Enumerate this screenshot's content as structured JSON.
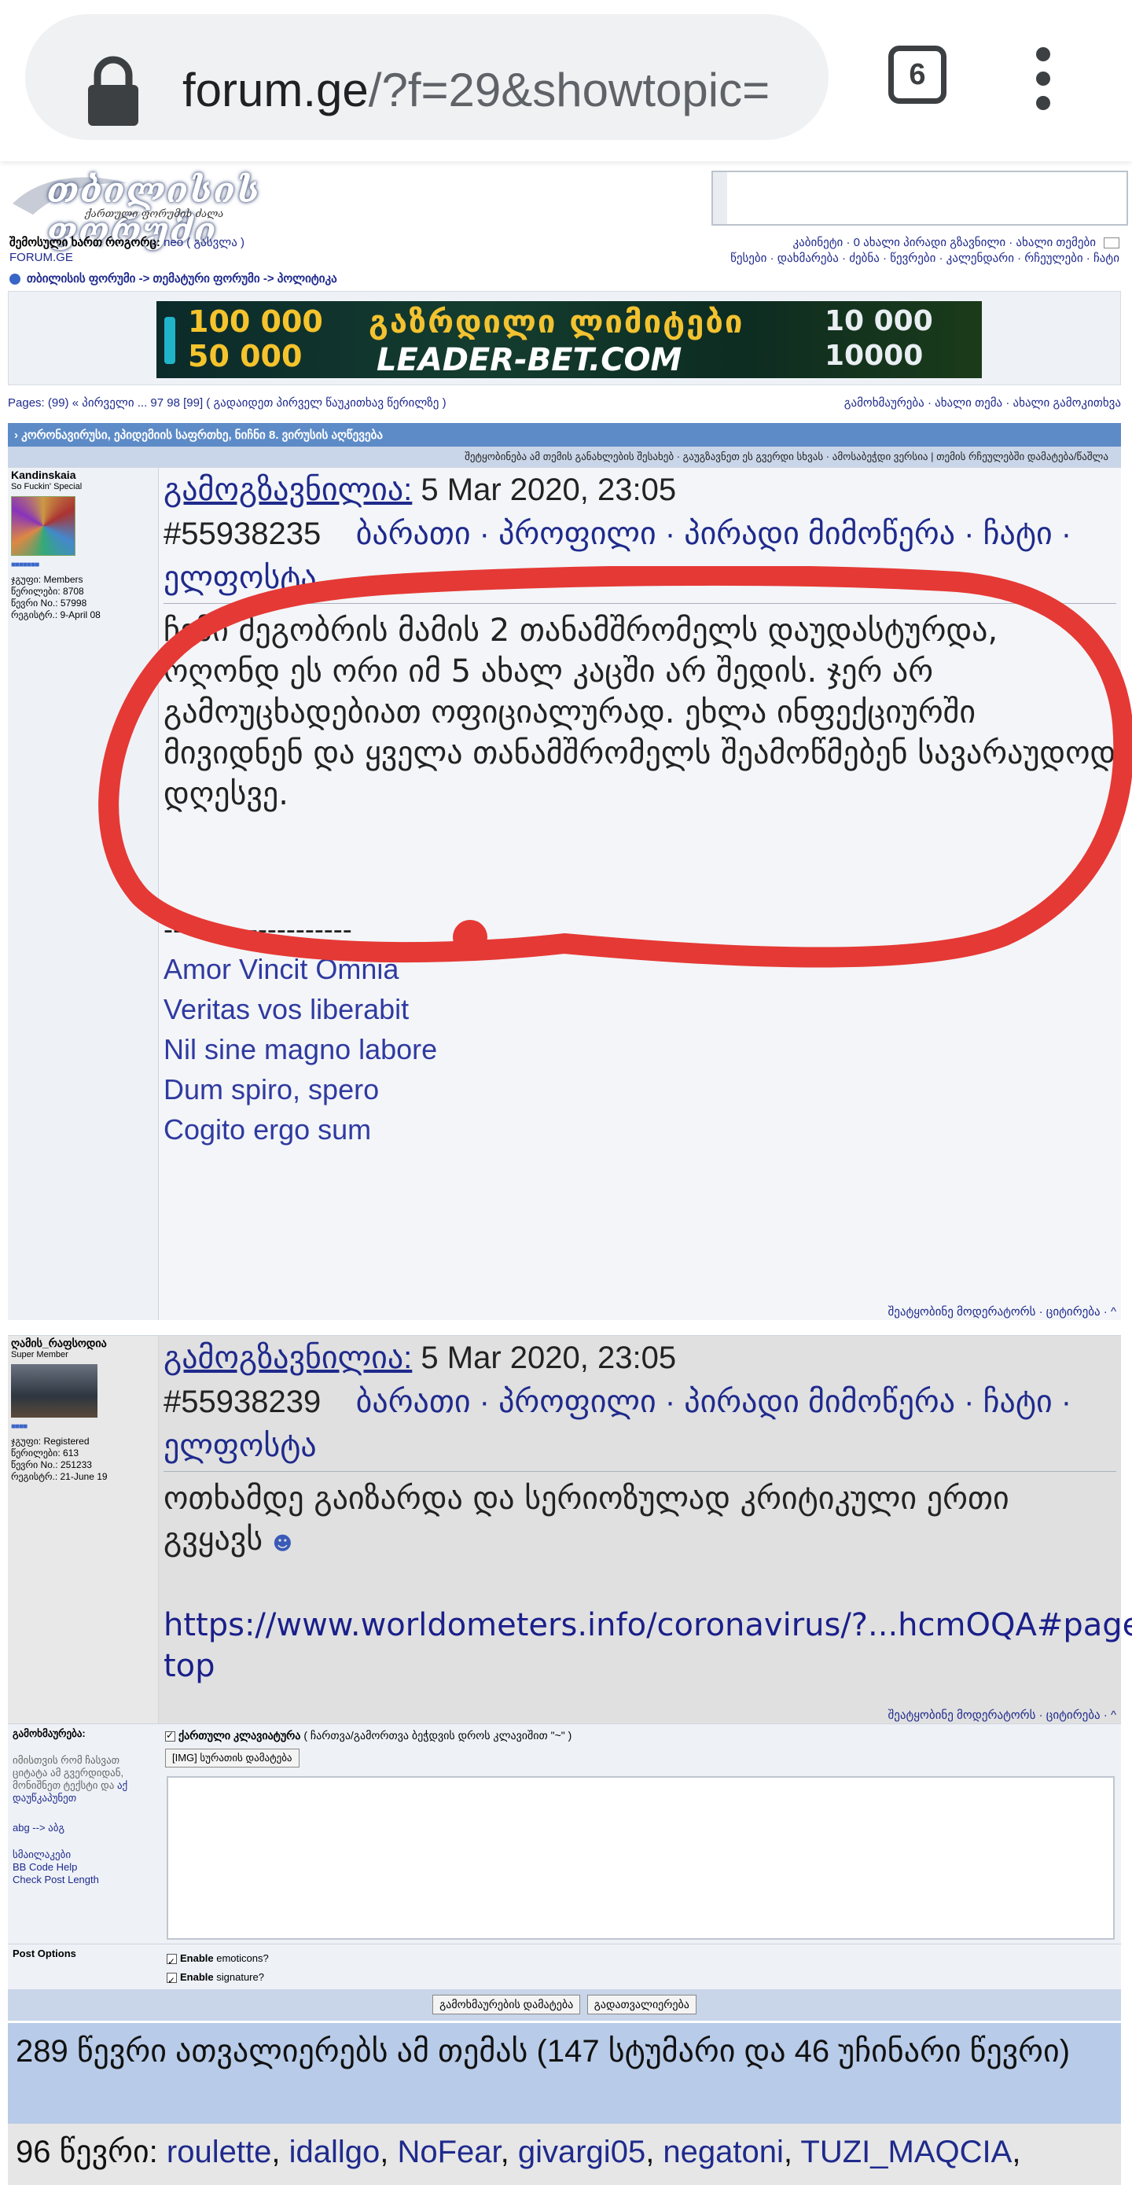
{
  "browser": {
    "url_host": "forum.ge",
    "url_path": "/?f=29&showtopic=",
    "tab_count": "6"
  },
  "header": {
    "logo_text": "თბილისის ფორუმი",
    "logo_sub": "ქართული ფორუმის ძალა",
    "login_prefix": "შემოსული ხართ როგორც:",
    "login_user": "neo",
    "logout": "( გასვლა )",
    "site_label": "FORUM.GE",
    "user_nav": "კაბინეტი · 0 ახალი პირადი გზავნილი · ახალი თემები",
    "site_nav": "წესები · დახმარება · ძებნა · წევრები · კალენდარი · რჩეულები · ჩატი"
  },
  "breadcrumb": "თბილისის ფორუმი -> თემატური ფორუმი -> პოლიტიკა",
  "banner": {
    "amount_1": "100 000",
    "amount_2": "50 000",
    "headline": "გაზრდილი ლიმიტები",
    "brand": "LEADER-BET.COM",
    "amount_3": "10 000",
    "amount_4": "10000"
  },
  "pagination": "Pages: (99) « პირველი ... 97 98 [99]  ( გადაიდეთ პირველ წაუკითხავ წერილზე )",
  "topic_actions": "გამოხმაურება · ახალი თემა · ახალი გამოკითხვა",
  "topic_title": "› კორონავირუსი, ეპიდემიის საფრთხე, ნიჩნი 8. ვირუსის აღწევება",
  "topic_tools": "შეტყობინება ამ თემის განახლების შესახებ  ·  გაუგზავნეთ ეს გვერდი სხვას  ·  ამოსაბეჭდი ვერსია  |  თემის რჩეულებში დამატება/წაშლა",
  "posts": [
    {
      "user": "Kandinskaia",
      "rank": "So Fuckin' Special",
      "group": "ჯგუფი: Members",
      "posts": "წერილები: 8708",
      "number": "წევრი No.: 57998",
      "registered": "რეგისტრ.: 9-April 08",
      "posted_label": "გამოგზავნილია:",
      "date": "5 Mar 2020, 23:05",
      "post_id": "#55938235",
      "links": "ბარათი · პროფილი · პირადი მიმოწერა · ჩატი · ელფოსტა",
      "text": "ჩემი მეგობრის მამის 2 თანამშრომელს დაუდასტურდა, ოღონდ ეს ორი იმ 5 ახალ კაცში არ შედის. ჯერ არ გამოუცხადებიათ ოფიციალურად. ეხლა ინფექციურში მივიდნენ და ყველა თანამშრომელს შეამოწმებენ სავარაუდოდ დღესვე.",
      "sig_sep": "--------------------",
      "signature": [
        "Amor Vincit Omnia",
        "Veritas vos liberabit",
        "Nil sine magno labore",
        "Dum spiro, spero",
        "Cogito ergo sum"
      ],
      "footer": "შეატყობინე მოდერატორს · ციტირება · ^"
    },
    {
      "user": "ღამის_რაფსოდია",
      "rank": "Super Member",
      "group": "ჯგუფი: Registered",
      "posts": "წერილები: 613",
      "number": "წევრი No.: 251233",
      "registered": "რეგისტრ.: 21-June 19",
      "posted_label": "გამოგზავნილია:",
      "date": "5 Mar 2020, 23:05",
      "post_id": "#55938239",
      "links": "ბარათი · პროფილი · პირადი მიმოწერა · ჩატი · ელფოსტა",
      "text": "ოთხამდე გაიზარდა და სერიოზულად კრიტიკული ერთი გვყავს",
      "link": "https://www.worldometers.info/coronavirus/?...hcmOQA#page-top",
      "footer": "შეატყობინე მოდერატორს · ციტირება · ^"
    }
  ],
  "reply": {
    "label": "გამოხმაურება:",
    "help": "იმისთვის რომ ჩასვათ ციტატა ამ გვერდიდან, მონიშნეთ ტექსტი და",
    "help_link": "აქ დაუწკაპუნეთ",
    "abg": "abg --> აბგ",
    "smilies": "სმაილაკები",
    "bbcode": "BB Code Help",
    "check": "Check Post Length",
    "keyboard_label": "ქართული კლავიატურა",
    "keyboard_hint": "( ჩართვა/გამორთვა ბეჭდვის დროს კლავიშით \"~\" )",
    "img_button": "[IMG] სურათის დამატება",
    "textarea_value": ""
  },
  "post_options": {
    "label": "Post Options",
    "emoticons_bold": "Enable",
    "emoticons": "emoticons?",
    "signature_bold": "Enable",
    "signature": "signature?"
  },
  "buttons": {
    "submit": "გამოხმაურების დამატება",
    "preview": "გადათვალიერება"
  },
  "viewers": "289 წევრი ათვალიერებს ამ თემას (147 სტუმარი და 46 უჩინარი წევრი)",
  "members_prefix": "96 წევრი:",
  "members": [
    "roulette",
    "idallgo",
    "NoFear",
    "givargi05",
    "negatoni",
    "TUZI_MAQCIA"
  ],
  "colors": {
    "annotation": "#e53935",
    "topic_bar": "#5d8bc7",
    "link": "#1f2a8c"
  }
}
